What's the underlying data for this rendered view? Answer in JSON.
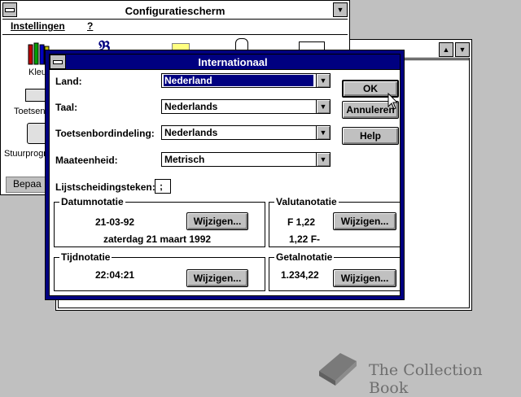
{
  "control_panel": {
    "title": "Configuratiescherm",
    "menu": [
      "Instellingen",
      "?"
    ],
    "icon_labels": [
      "Kleu",
      "Toetsen",
      "Stuurprogra"
    ],
    "status_text": "Bepaa"
  },
  "dialog": {
    "title": "Internationaal",
    "fields": {
      "land_label": "Land:",
      "land_value": "Nederland",
      "taal_label": "Taal:",
      "taal_value": "Nederlands",
      "toets_label": "Toetsenbordindeling:",
      "toets_value": "Nederlands",
      "maat_label": "Maateenheid:",
      "maat_value": "Metrisch",
      "lijst_label": "Lijstscheidingsteken:",
      "lijst_value": ";"
    },
    "buttons": {
      "ok": "OK",
      "annuleren": "Annuleren",
      "help": "Help"
    },
    "groups": {
      "datum": {
        "title": "Datumnotatie",
        "short": "21-03-92",
        "long": "zaterdag 21 maart 1992",
        "button": "Wijzigen..."
      },
      "valuta": {
        "title": "Valutanotatie",
        "pos": "F 1,22",
        "neg": "1,22 F-",
        "button": "Wijzigen..."
      },
      "tijd": {
        "title": "Tijdnotatie",
        "value": "22:04:21",
        "button": "Wijzigen..."
      },
      "getal": {
        "title": "Getalnotatie",
        "value": "1.234,22",
        "button": "Wijzigen..."
      }
    }
  },
  "watermark": {
    "text": "The Collection Book"
  },
  "colors": {
    "desktop": "#c0c0c0",
    "active_title": "#000080",
    "selection": "#000080"
  }
}
